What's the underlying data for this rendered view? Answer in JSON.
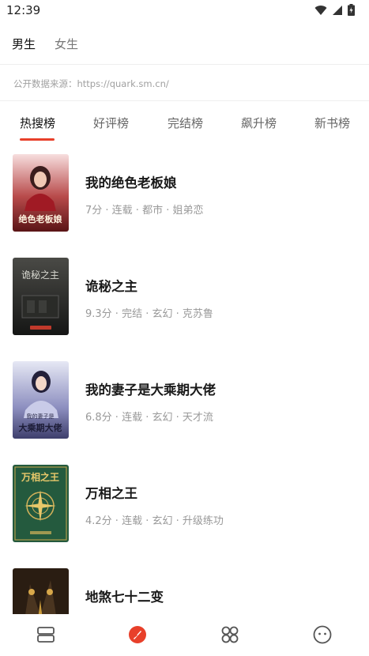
{
  "status": {
    "time": "12:39"
  },
  "gender_tabs": [
    {
      "label": "男生",
      "active": true
    },
    {
      "label": "女生",
      "active": false
    }
  ],
  "source_text": "公开数据来源：https://quark.sm.cn/",
  "rank_tabs": [
    {
      "label": "热搜榜",
      "active": true
    },
    {
      "label": "好评榜",
      "active": false
    },
    {
      "label": "完结榜",
      "active": false
    },
    {
      "label": "飙升榜",
      "active": false
    },
    {
      "label": "新书榜",
      "active": false
    }
  ],
  "books": [
    {
      "title": "我的绝色老板娘",
      "meta": "7分 · 连载 · 都市 · 姐弟恋",
      "cover_text": "绝色老板娘",
      "cover_colors": [
        "#f6d9d9",
        "#c0282d"
      ]
    },
    {
      "title": "诡秘之主",
      "meta": "9.3分 · 完结 · 玄幻 · 克苏鲁",
      "cover_text": "诡秘之主",
      "cover_colors": [
        "#3a3a38",
        "#1c1d1c"
      ]
    },
    {
      "title": "我的妻子是大乘期大佬",
      "meta": "6.8分 · 连载 · 玄幻 · 天才流",
      "cover_text": "我的妻子是大乘期大佬",
      "cover_colors": [
        "#dfe2f2",
        "#5b5f96"
      ]
    },
    {
      "title": "万相之王",
      "meta": "4.2分 · 连载 · 玄幻 · 升级练功",
      "cover_text": "万相之王",
      "cover_colors": [
        "#2f6b4a",
        "#1c4631"
      ]
    },
    {
      "title": "地煞七十二变",
      "meta": "",
      "cover_text": "",
      "cover_colors": [
        "#3b2a1c",
        "#1a120c"
      ]
    }
  ]
}
